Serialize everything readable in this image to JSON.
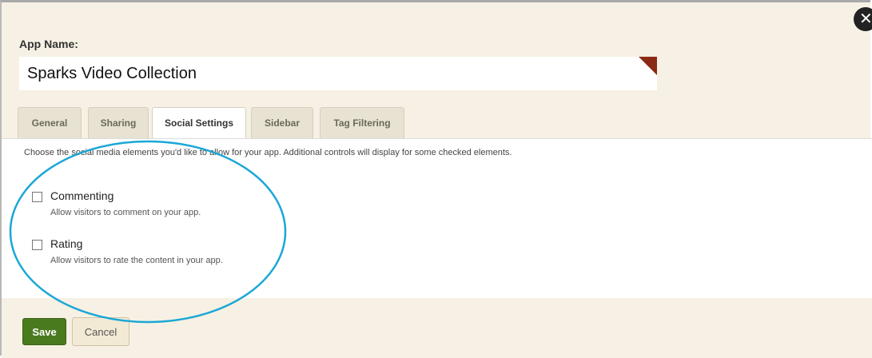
{
  "dialog": {
    "close_glyph": "✕",
    "app_name_label": "App Name:",
    "app_name_value": "Sparks Video Collection"
  },
  "tabs": [
    {
      "label": "General",
      "active": false
    },
    {
      "label": "Sharing",
      "active": false
    },
    {
      "label": "Social Settings",
      "active": true
    },
    {
      "label": "Sidebar",
      "active": false
    },
    {
      "label": "Tag Filtering",
      "active": false
    }
  ],
  "social": {
    "description": "Choose the social media elements you'd like to allow for your app. Additional controls will display for some checked elements.",
    "options": [
      {
        "label": "Commenting",
        "help": "Allow visitors to comment on your app.",
        "checked": false
      },
      {
        "label": "Rating",
        "help": "Allow visitors to rate the content in your app.",
        "checked": false
      }
    ]
  },
  "footer": {
    "save_label": "Save",
    "cancel_label": "Cancel"
  },
  "colors": {
    "save": "#4a7a1e",
    "annotation": "#1ba7d6",
    "flag": "#8b2a14"
  }
}
